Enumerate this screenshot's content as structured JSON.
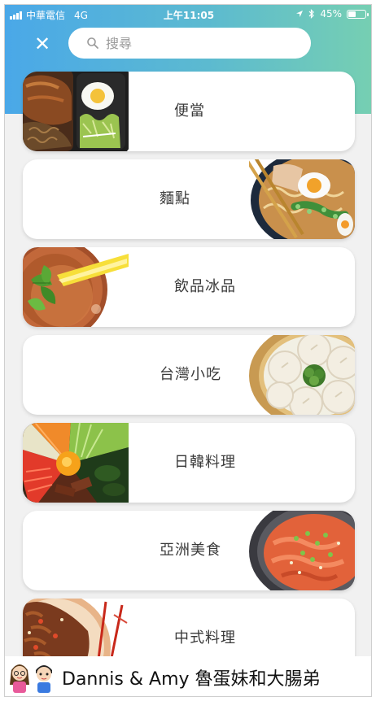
{
  "status_bar": {
    "carrier": "中華電信",
    "network": "4G",
    "time": "上午11:05",
    "battery_percent": "45%",
    "battery_level": 0.45
  },
  "search": {
    "placeholder": "搜尋"
  },
  "categories": [
    {
      "label": "便當",
      "image": "bento-image"
    },
    {
      "label": "麵點",
      "image": "ramen-image"
    },
    {
      "label": "飲品冰品",
      "image": "iced-tea-image"
    },
    {
      "label": "台灣小吃",
      "image": "dumplings-image"
    },
    {
      "label": "日韓料理",
      "image": "bibimbap-image"
    },
    {
      "label": "亞洲美食",
      "image": "poke-bowl-image"
    },
    {
      "label": "中式料理",
      "image": "stir-fry-image"
    }
  ],
  "watermark": {
    "text": "Dannis & Amy 魯蛋妹和大腸弟"
  },
  "colors": {
    "header_gradient_start": "#4aa8e8",
    "header_gradient_end": "#76cfb2",
    "background": "#f1f1f1",
    "card": "#ffffff",
    "label_text": "#3a3a3a"
  }
}
